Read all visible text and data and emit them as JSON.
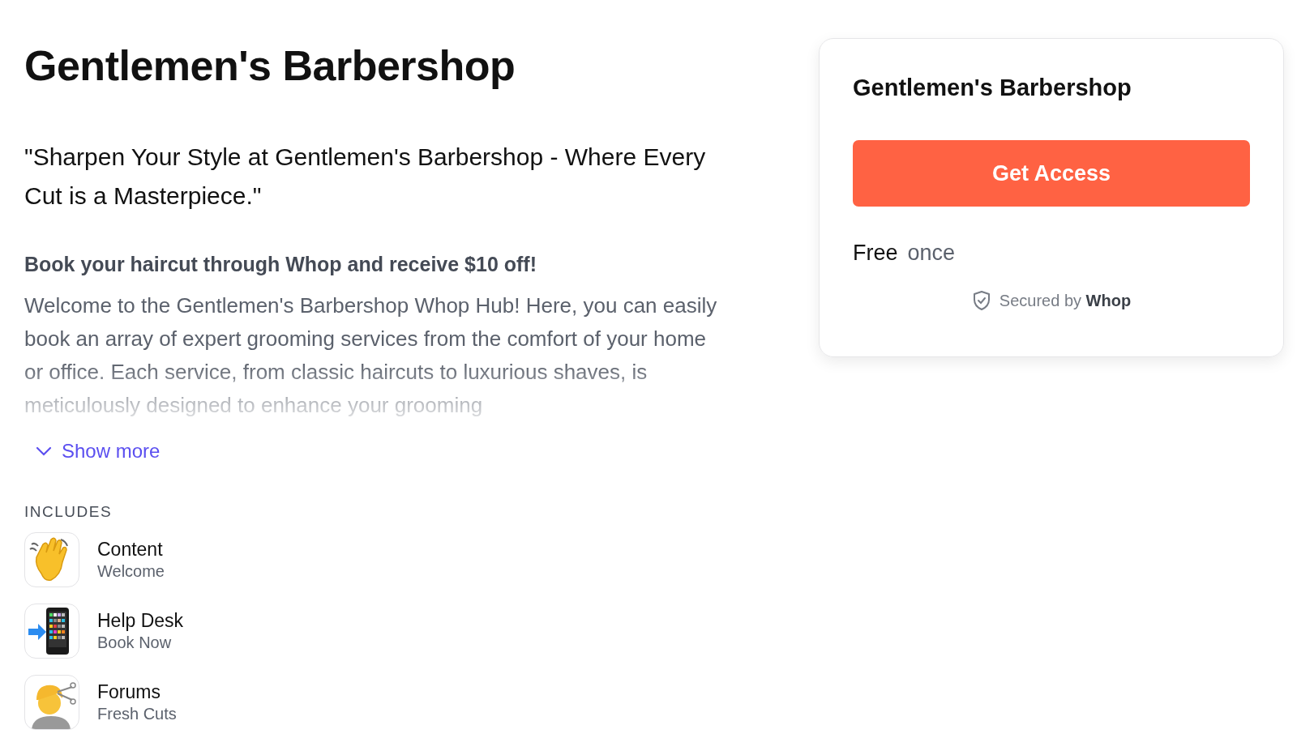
{
  "title": "Gentlemen's Barbershop",
  "tagline": "\"Sharpen Your Style at Gentlemen's Barbershop - Where Every Cut is a Masterpiece.\"",
  "headline": "Book your haircut through Whop and receive $10 off!",
  "description": "Welcome to the Gentlemen's Barbershop Whop Hub! Here, you can easily book an array of expert grooming services from the comfort of your home or office. Each service, from classic haircuts to luxurious shaves, is meticulously designed to enhance your grooming",
  "description_faded": true,
  "show_more": {
    "label": "Show more",
    "expanded": false
  },
  "includes": {
    "heading": "INCLUDES",
    "items": [
      {
        "kind": "hand",
        "name": "Content",
        "subtitle": "Welcome"
      },
      {
        "kind": "phone",
        "name": "Help Desk",
        "subtitle": "Book Now"
      },
      {
        "kind": "haircut",
        "name": "Forums",
        "subtitle": "Fresh Cuts"
      }
    ]
  },
  "card": {
    "title": "Gentlemen's Barbershop",
    "button": "Get Access",
    "price": "Free",
    "period": "once",
    "secured": "Secured by **Whop**"
  }
}
